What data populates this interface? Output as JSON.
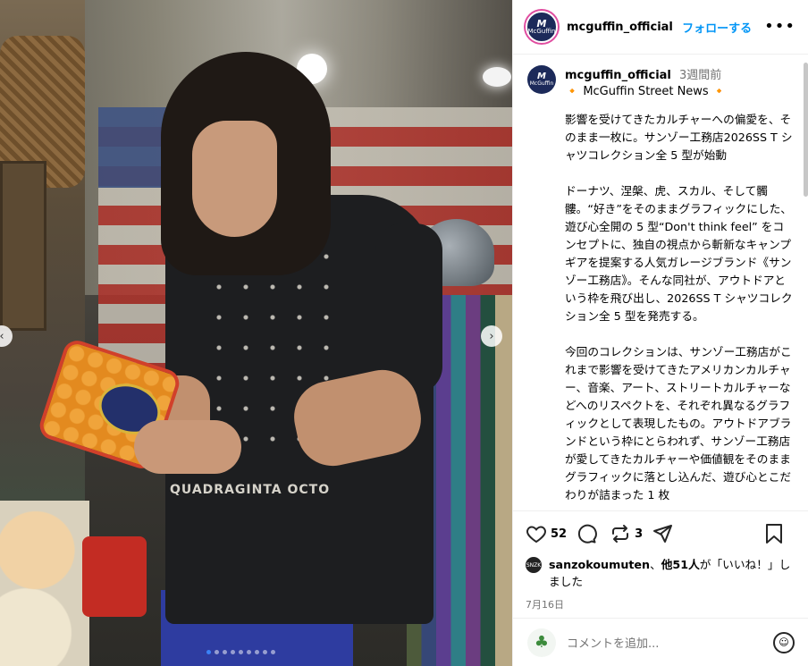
{
  "photo": {
    "shirt_print_text": "QUADRAGINTA OCTO",
    "carousel_dot_count": 9,
    "active_dot_index": 0,
    "prev_arrow": "‹",
    "next_arrow": "›"
  },
  "header": {
    "avatar_text": "McGuffin",
    "username": "mcguffin_official",
    "follow_label": "フォローする",
    "more_label": "•••"
  },
  "caption": {
    "avatar_text": "McGuffin",
    "username": "mcguffin_official",
    "time_ago": "3週間前",
    "subtitle": "🔸 McGuffin Street News 🔸",
    "body": "影響を受けてきたカルチャーへの偏愛を、そのまま一枚に。サンゾー工務店2026SS T シャツコレクション全 5 型が始動\n\nドーナツ、涅槃、虎、スカル、そして髑髏。“好き”をそのままグラフィックにした、遊び心全開の 5 型“Don't think feel” をコンセプトに、独自の視点から斬新なキャンプギアを提案する人気ガレージブランド《サンゾー工務店》。そんな同社が、アウトドアという枠を飛び出し、2026SS T シャツコレクション全 5 型を発売する。\n\n今回のコレクションは、サンゾー工務店がこれまで影響を受けてきたアメリカンカルチャー、音楽、アート、ストリートカルチャーなどへのリスペクトを、それぞれ異なるグラフィックとして表現したもの。アウトドアブランドという枠にとらわれず、サンゾー工務店が愛してきたカルチャーや価値観をそのままグラフィックに落とし込んだ、遊び心とこだわりが詰まった 1 枚"
  },
  "actions": {
    "like_count": "52",
    "share_count": "3",
    "icons": [
      "heart-icon",
      "comment-icon",
      "repost-icon",
      "send-icon",
      "bookmark-icon"
    ]
  },
  "likes": {
    "avatar_text": "SNZK",
    "user": "sanzokoumuten",
    "text_mid": "、",
    "others": "他51人",
    "suffix": "が「いいね！」しました"
  },
  "date": "7月16日",
  "comment": {
    "placeholder": "コメントを追加...",
    "avatar_glyph": "♣",
    "emoji_glyph": "☺"
  },
  "colors": {
    "accent": "#0095f6",
    "muted": "#737373",
    "brand_navy": "#1c2a5a"
  }
}
